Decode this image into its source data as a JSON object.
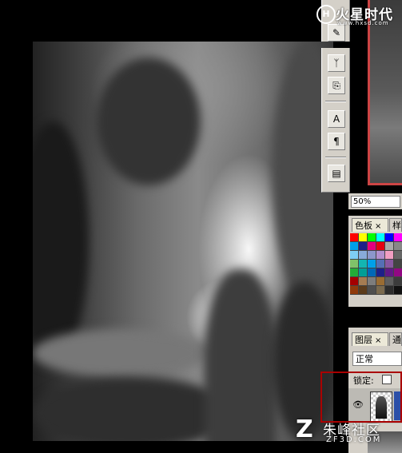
{
  "navigator": {
    "zoom_value": "50%"
  },
  "toolbox": {
    "tools": [
      {
        "icon": "eyedropper-icon",
        "glyph": "✎"
      },
      {
        "icon": "brush-icon",
        "glyph": "ᛉ"
      },
      {
        "icon": "history-brush-icon",
        "glyph": "⎘"
      },
      {
        "icon": "text-icon",
        "glyph": "A"
      },
      {
        "icon": "paragraph-icon",
        "glyph": "¶"
      },
      {
        "icon": "layer-comps-icon",
        "glyph": "▤"
      }
    ]
  },
  "swatches_panel": {
    "tab_active": "色板",
    "tab_other": "样",
    "close_glyph": "×",
    "colors": [
      "#ff0000",
      "#ffff00",
      "#00ff00",
      "#00ffff",
      "#0000ff",
      "#ff00ff",
      "#00a0e9",
      "#1d2088",
      "#e4007f",
      "#e60012",
      "#aaaaaa",
      "#888888",
      "#7ecef4",
      "#88abda",
      "#8c97cb",
      "#b28fce",
      "#f19ec2",
      "#666666",
      "#80c269",
      "#13b5b1",
      "#00a0e9",
      "#556fb5",
      "#8957a1",
      "#444444",
      "#22ac38",
      "#009e96",
      "#0068b7",
      "#1d2088",
      "#601986",
      "#920783",
      "#a40000",
      "#a57c52",
      "#7d7d7d",
      "#996c33",
      "#5f5f5f",
      "#3c3c3c",
      "#8f3a0c",
      "#5c3c1c",
      "#4f4f4f",
      "#7a6a4f",
      "#2d2d2d",
      "#111111"
    ]
  },
  "layers_panel": {
    "tab_active": "图层",
    "tab_other": "通",
    "close_glyph": "×",
    "blend_mode": "正常",
    "lock_label": "锁定:",
    "eye_glyph": "👁"
  },
  "watermarks": {
    "top_name": "火星时代",
    "top_url": "www.hxsd.com",
    "bottom_logo": "Z",
    "bottom_name": "朱峰社区",
    "bottom_url": "ZF3D.COM"
  },
  "colors": {
    "panel_bg": "#d4d0c8",
    "highlight": "#aa0000",
    "layer_selected": "#2b4fa8"
  }
}
